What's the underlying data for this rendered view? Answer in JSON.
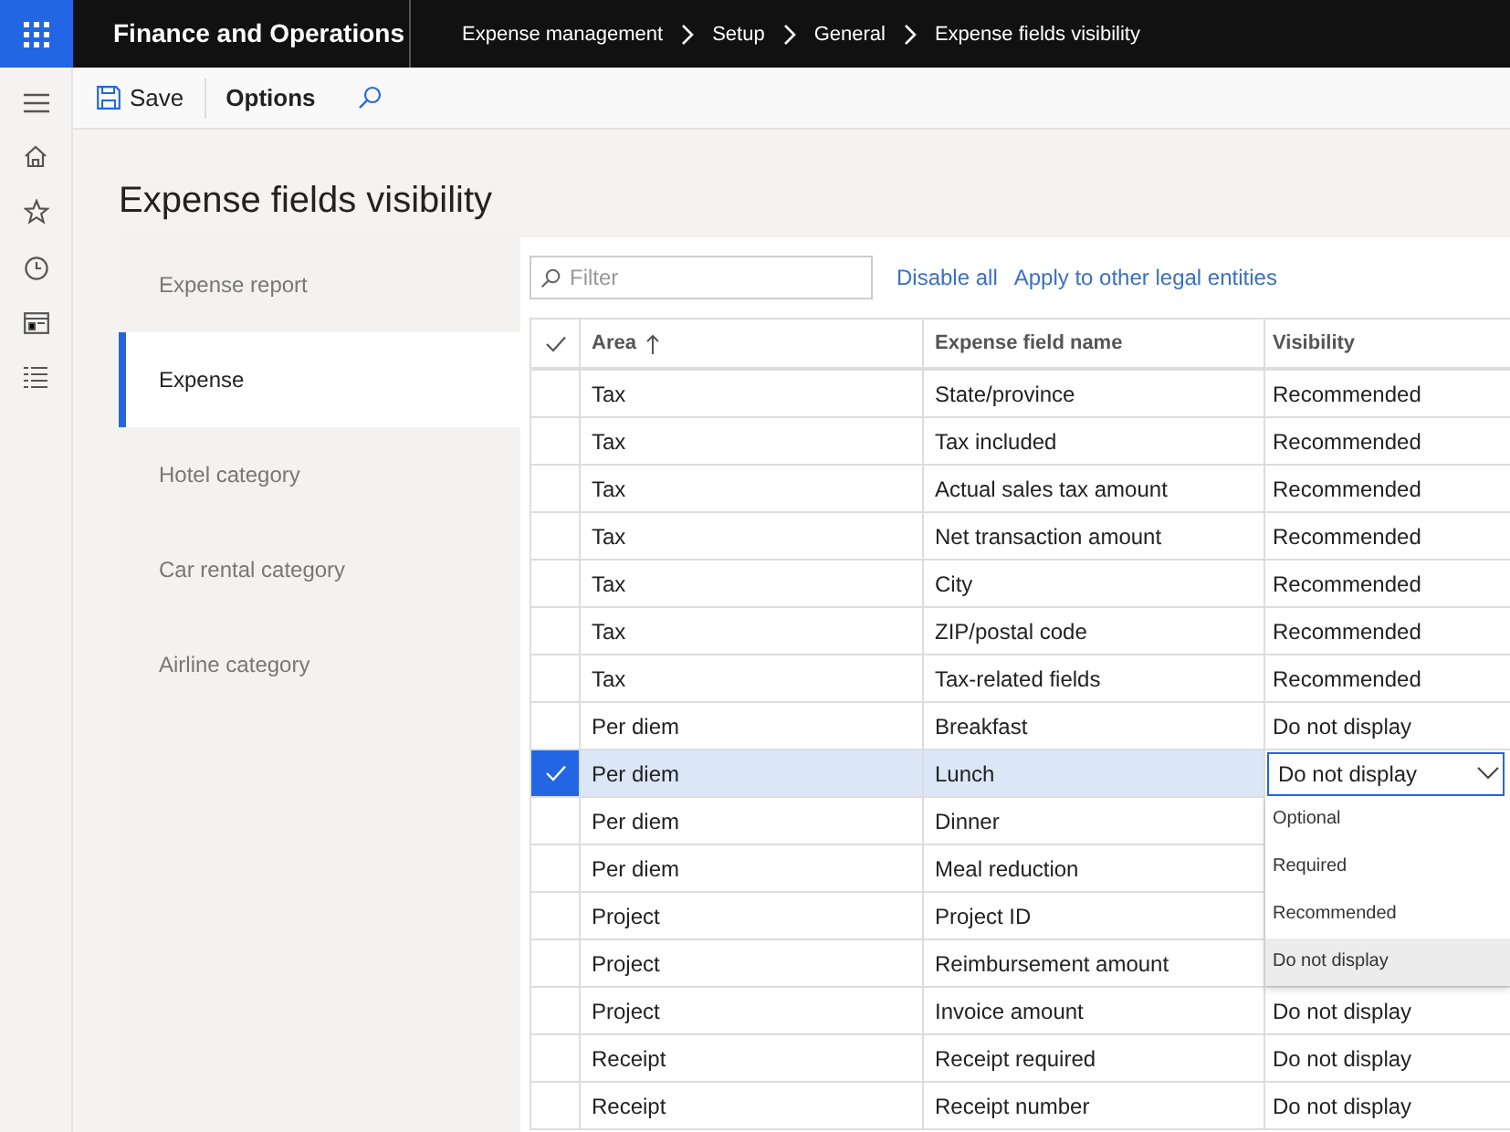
{
  "app_bar": {
    "app_title": "Finance and Operations",
    "breadcrumbs": [
      "Expense management",
      "Setup",
      "General",
      "Expense fields visibility"
    ]
  },
  "action_bar": {
    "save": "Save",
    "options": "Options"
  },
  "page_title": "Expense fields visibility",
  "tabs": [
    {
      "label": "Expense report",
      "selected": false
    },
    {
      "label": "Expense",
      "selected": true
    },
    {
      "label": "Hotel category",
      "selected": false
    },
    {
      "label": "Car rental category",
      "selected": false
    },
    {
      "label": "Airline category",
      "selected": false
    }
  ],
  "grid_toolbar": {
    "filter_placeholder": "Filter",
    "links": [
      "Disable all",
      "Apply to other legal entities"
    ]
  },
  "table": {
    "columns": [
      "Area",
      "Expense field name",
      "Visibility"
    ],
    "rows": [
      {
        "area": "Tax",
        "field": "State/province",
        "visibility": "Recommended",
        "selected": false
      },
      {
        "area": "Tax",
        "field": "Tax included",
        "visibility": "Recommended",
        "selected": false
      },
      {
        "area": "Tax",
        "field": "Actual sales tax amount",
        "visibility": "Recommended",
        "selected": false
      },
      {
        "area": "Tax",
        "field": "Net transaction amount",
        "visibility": "Recommended",
        "selected": false
      },
      {
        "area": "Tax",
        "field": "City",
        "visibility": "Recommended",
        "selected": false
      },
      {
        "area": "Tax",
        "field": "ZIP/postal code",
        "visibility": "Recommended",
        "selected": false
      },
      {
        "area": "Tax",
        "field": "Tax-related fields",
        "visibility": "Recommended",
        "selected": false
      },
      {
        "area": "Per diem",
        "field": "Breakfast",
        "visibility": "Do not display",
        "selected": false
      },
      {
        "area": "Per diem",
        "field": "Lunch",
        "visibility": "Do not display",
        "selected": true
      },
      {
        "area": "Per diem",
        "field": "Dinner",
        "selected": false
      },
      {
        "area": "Per diem",
        "field": "Meal reduction",
        "selected": false
      },
      {
        "area": "Project",
        "field": "Project ID",
        "selected": false
      },
      {
        "area": "Project",
        "field": "Reimbursement amount",
        "selected": false
      },
      {
        "area": "Project",
        "field": "Invoice amount",
        "visibility": "Do not display",
        "selected": false
      },
      {
        "area": "Receipt",
        "field": "Receipt required",
        "visibility": "Do not display",
        "selected": false
      },
      {
        "area": "Receipt",
        "field": "Receipt number",
        "visibility": "Do not display",
        "selected": false
      }
    ]
  },
  "visibility_dropdown": {
    "options": [
      {
        "label": "Optional",
        "selected": false
      },
      {
        "label": "Required",
        "selected": false
      },
      {
        "label": "Recommended",
        "selected": false
      },
      {
        "label": "Do not display",
        "selected": true
      }
    ]
  }
}
